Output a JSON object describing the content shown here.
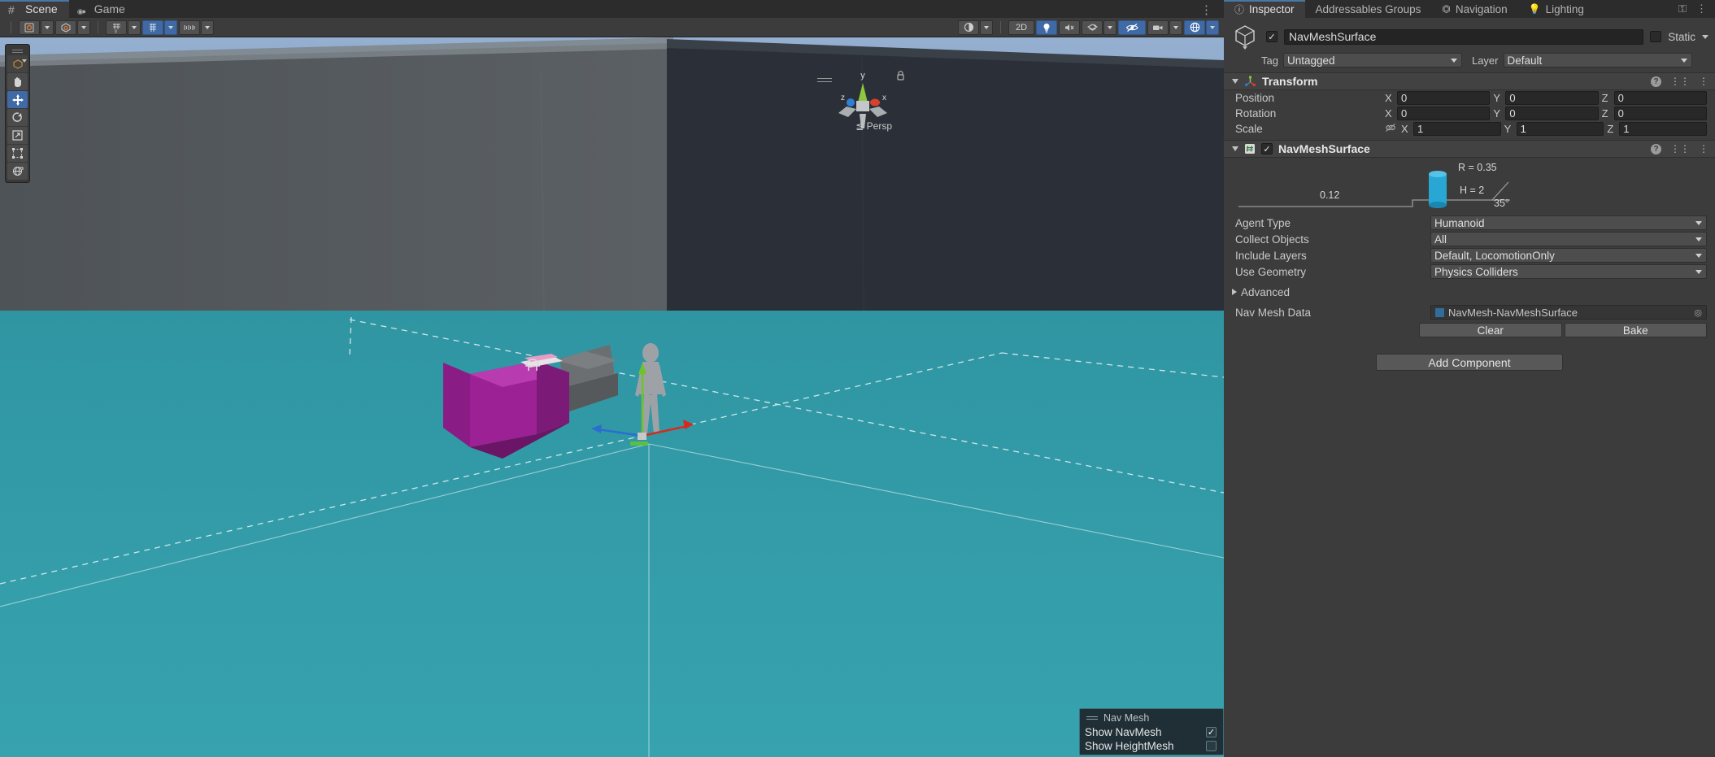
{
  "scene": {
    "tabs": [
      {
        "label": "Scene",
        "icon": "grid-icon",
        "active": true
      },
      {
        "label": "Game",
        "icon": "gamepad-icon",
        "active": false
      }
    ],
    "overflow_menu": "⋮",
    "toolbar_left": [
      {
        "name": "draw-mode-dropdown",
        "glyph": "◎"
      },
      {
        "name": "shading-mode-dropdown",
        "glyph": "⬡"
      },
      {
        "name": "2d-toggle",
        "glyph": "#▾"
      },
      {
        "name": "grid-snap-toggle",
        "glyph": "⌗"
      },
      {
        "name": "grid-size-dropdown",
        "glyph": "⦀"
      }
    ],
    "toolbar_right": [
      {
        "name": "gizmo-shading-button",
        "label": "◐"
      },
      {
        "name": "2d-button",
        "label": "2D"
      },
      {
        "name": "lighting-button",
        "label": "Ὂ1"
      },
      {
        "name": "audio-button",
        "label": "♪"
      },
      {
        "name": "fx-button",
        "label": "✦"
      },
      {
        "name": "hidden-objects-button",
        "label": "⊘"
      },
      {
        "name": "camera-button",
        "label": "■"
      },
      {
        "name": "gizmos-button",
        "label": "⬤"
      }
    ],
    "tools": [
      {
        "name": "pivot-rotation-dropdown",
        "glyph": "⬡",
        "selected": false
      },
      {
        "name": "hand-tool",
        "glyph": "✋",
        "selected": false
      },
      {
        "name": "move-tool",
        "glyph": "✥",
        "selected": true
      },
      {
        "name": "rotate-tool",
        "glyph": "↺",
        "selected": false
      },
      {
        "name": "scale-tool",
        "glyph": "↗",
        "selected": false
      },
      {
        "name": "rect-tool",
        "glyph": "⬚",
        "selected": false
      },
      {
        "name": "transform-tool",
        "glyph": "⊕",
        "selected": false
      }
    ],
    "gizmo": {
      "axis_x": "x",
      "axis_y": "y",
      "axis_z": "z",
      "projection": "≦ Persp",
      "color_x": "#d9412c",
      "color_y": "#8ec63f",
      "color_z": "#2f7fd4"
    },
    "navmesh_overlay": {
      "title": "Nav Mesh",
      "rows": [
        {
          "label": "Show NavMesh",
          "checked": true
        },
        {
          "label": "Show HeightMesh",
          "checked": false
        }
      ]
    },
    "colors": {
      "navmesh_fill": "#2f9ba8",
      "sky": "#8ba8c9",
      "wall_light": "#53585c",
      "wall_dark": "#2b3038",
      "accent_blue": "#3f6aa5"
    }
  },
  "inspector": {
    "tabs": [
      {
        "label": "Inspector",
        "icon": "info-icon",
        "active": true
      },
      {
        "label": "Addressables Groups",
        "icon": "",
        "active": false
      },
      {
        "label": "Navigation",
        "icon": "navigation-icon",
        "active": false
      },
      {
        "label": "Lighting",
        "icon": "bulb-icon",
        "active": false
      }
    ],
    "lock_icon": "⚿",
    "menu_icon": "⋮",
    "gameobject": {
      "enabled": true,
      "name": "NavMeshSurface",
      "static_label": "Static",
      "static_checked": false,
      "tag_label": "Tag",
      "tag_value": "Untagged",
      "layer_label": "Layer",
      "layer_value": "Default"
    },
    "transform": {
      "title": "Transform",
      "expanded": true,
      "rows": [
        {
          "label": "Position",
          "x": "0",
          "y": "0",
          "z": "0",
          "linked": false
        },
        {
          "label": "Rotation",
          "x": "0",
          "y": "0",
          "z": "0",
          "linked": false
        },
        {
          "label": "Scale",
          "x": "1",
          "y": "1",
          "z": "1",
          "linked": true
        }
      ],
      "axis_labels": {
        "x": "X",
        "y": "Y",
        "z": "Z"
      }
    },
    "navmeshsurface": {
      "title": "NavMeshSurface",
      "enabled": true,
      "expanded": true,
      "diagram": {
        "radius_label": "R = 0.35",
        "height_label": "H = 2",
        "step_label": "0.12",
        "slope_label": "35°",
        "agent_color": "#29a7d4"
      },
      "fields": [
        {
          "label": "Agent Type",
          "value": "Humanoid",
          "type": "dropdown"
        },
        {
          "label": "Collect Objects",
          "value": "All",
          "type": "dropdown"
        },
        {
          "label": "Include Layers",
          "value": "Default, LocomotionOnly",
          "type": "dropdown"
        },
        {
          "label": "Use Geometry",
          "value": "Physics Colliders",
          "type": "dropdown"
        }
      ],
      "advanced_label": "Advanced",
      "advanced_expanded": false,
      "navmesh_data_label": "Nav Mesh Data",
      "navmesh_data_value": "NavMesh-NavMeshSurface",
      "clear_button": "Clear",
      "bake_button": "Bake"
    },
    "add_component_button": "Add Component"
  }
}
